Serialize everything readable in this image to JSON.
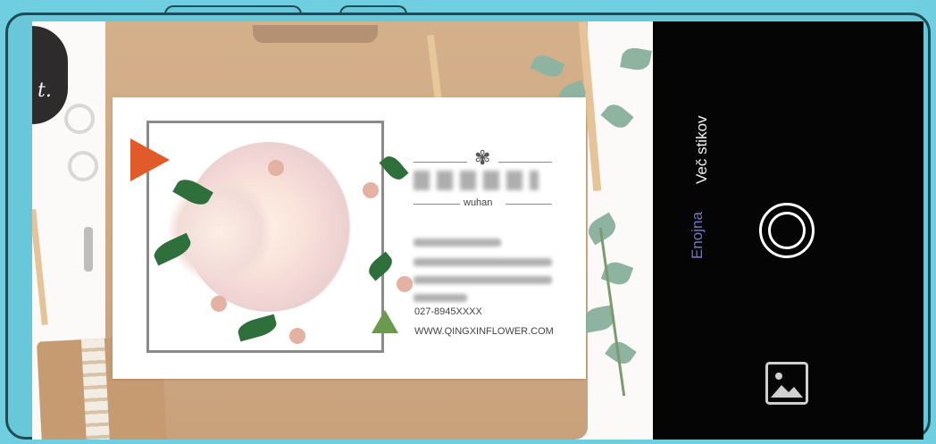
{
  "card": {
    "location": "wuhan",
    "phone": "027-8945XXXX",
    "website": "WWW.QINGXINFLOWER.COM"
  },
  "camera": {
    "modes": {
      "single": "Enojna",
      "multi": "Več stikov"
    },
    "selected_mode": "single",
    "accent_color": "#7276c6",
    "shutter_icon": "shutter-button",
    "gallery_icon": "gallery-icon"
  }
}
